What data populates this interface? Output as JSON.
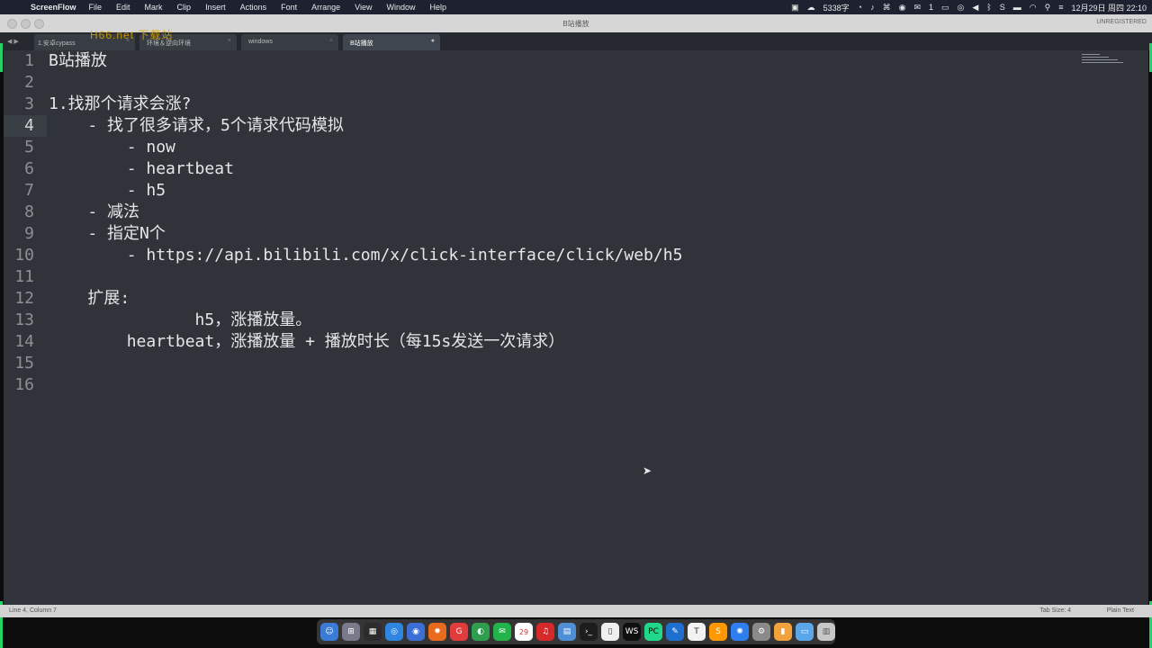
{
  "menubar": {
    "app": "ScreenFlow",
    "items": [
      "File",
      "Edit",
      "Mark",
      "Clip",
      "Insert",
      "Actions",
      "Font",
      "Arrange",
      "View",
      "Window",
      "Help"
    ],
    "word_count": "5338字",
    "wechat_count": "1",
    "datetime": "12月29日 周四  22:10"
  },
  "window": {
    "title": "B站播放",
    "unregistered": "UNREGISTERED"
  },
  "tabs": [
    {
      "label": "1.安卓cypass",
      "active": false
    },
    {
      "label": "环境＆逆向环境",
      "active": false
    },
    {
      "label": "windows",
      "active": false
    },
    {
      "label": "B站播放",
      "active": true
    }
  ],
  "watermark": "H66.net 下载站",
  "editor": {
    "current_line": 4,
    "lines": [
      {
        "n": "1",
        "text": "B站播放"
      },
      {
        "n": "2",
        "text": ""
      },
      {
        "n": "3",
        "text": "1.找那个请求会涨?"
      },
      {
        "n": "4",
        "text": "    - 找了很多请求，5个请求代码模拟"
      },
      {
        "n": "5",
        "text": "        - now"
      },
      {
        "n": "6",
        "text": "        - heartbeat"
      },
      {
        "n": "7",
        "text": "        - h5"
      },
      {
        "n": "8",
        "text": "    - 减法"
      },
      {
        "n": "9",
        "text": "    - 指定N个"
      },
      {
        "n": "10",
        "text": "        - https://api.bilibili.com/x/click-interface/click/web/h5"
      },
      {
        "n": "11",
        "text": ""
      },
      {
        "n": "12",
        "text": "    扩展:"
      },
      {
        "n": "13",
        "text": "               h5，涨播放量。"
      },
      {
        "n": "14",
        "text": "        heartbeat，涨播放量 + 播放时长（每15s发送一次请求）"
      },
      {
        "n": "15",
        "text": ""
      },
      {
        "n": "16",
        "text": ""
      }
    ]
  },
  "statusbar": {
    "position": "Line 4, Column 7",
    "tab_size": "Tab Size: 4",
    "syntax": "Plain Text"
  },
  "dock": {
    "calendar_day": "29",
    "items": [
      "finder-icon",
      "launchpad-icon",
      "mission-control-icon",
      "safari-icon",
      "chrome-icon",
      "firefox-icon",
      "git-icon",
      "chrome-alt-icon",
      "wechat-icon",
      "netease-music-icon",
      "preview-icon",
      "terminal-icon",
      "finder-small-icon",
      "webstorm-icon",
      "pycharm-icon",
      "xcode-icon",
      "typora-icon",
      "sublime-icon",
      "messages-icon",
      "settings-icon",
      "folder-icon",
      "downloads-icon",
      "trash-icon"
    ]
  }
}
